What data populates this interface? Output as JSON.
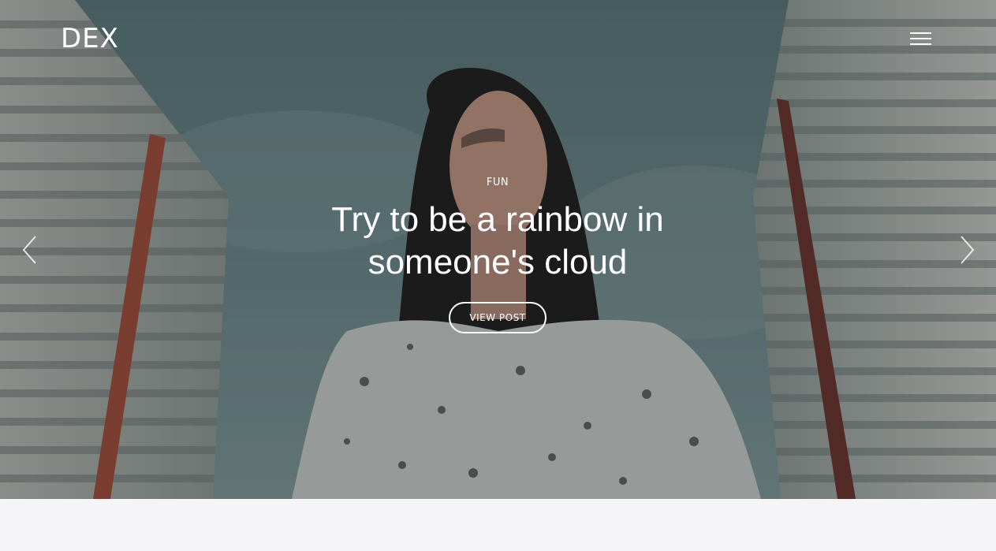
{
  "site": {
    "logo": "DEX"
  },
  "header": {
    "menu_icon": "hamburger-menu-icon"
  },
  "slider": {
    "prev_icon": "chevron-left-icon",
    "next_icon": "chevron-right-icon",
    "slide": {
      "category": "FUN",
      "title_line1": "Try to be a rainbow in",
      "title_line2": "someone's cloud",
      "button_label": "VIEW POST"
    }
  },
  "colors": {
    "overlay": "#142024",
    "text": "#ffffff",
    "page_background": "#f5f5f7"
  }
}
